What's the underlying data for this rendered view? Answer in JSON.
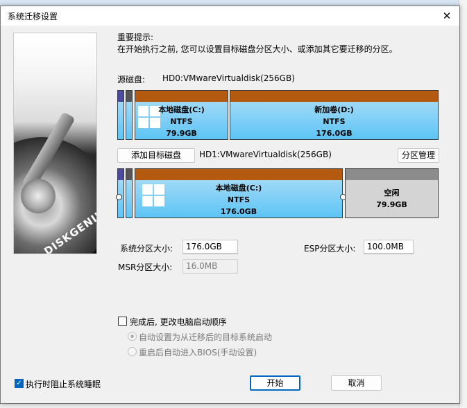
{
  "window": {
    "title": "系统迁移设置",
    "close_glyph": "✕"
  },
  "notice": {
    "heading": "重要提示:",
    "body": "在开始执行之前, 您可以设置目标磁盘分区大小、或添加其它要迁移的分区。"
  },
  "source": {
    "label": "源磁盘:",
    "disk_name": "HD0:VMwareVirtualdisk(256GB)",
    "partitions": [
      {
        "name": "本地磁盘(C:)",
        "fs": "NTFS",
        "size": "79.9GB"
      },
      {
        "name": "新加卷(D:)",
        "fs": "NTFS",
        "size": "176.0GB"
      }
    ]
  },
  "target": {
    "add_button": "添加目标磁盘",
    "disk_name": "HD1:VMwareVirtualdisk(256GB)",
    "manage_button": "分区管理",
    "partitions": [
      {
        "name": "本地磁盘(C:)",
        "fs": "NTFS",
        "size": "176.0GB"
      },
      {
        "name": "空闲",
        "size": "79.9GB"
      }
    ]
  },
  "sizes": {
    "system_label": "系统分区大小:",
    "system_value": "176.0GB",
    "esp_label": "ESP分区大小:",
    "esp_value": "100.0MB",
    "msr_label": "MSR分区大小:",
    "msr_value": "16.0MB"
  },
  "boot": {
    "change_order_label": "完成后, 更改电脑启动顺序",
    "change_order_checked": false,
    "option_auto": "自动设置为从迁移后的目标系统启动",
    "option_bios": "重启后自动进入BIOS(手动设置)"
  },
  "footer": {
    "prevent_sleep_label": "执行时阻止系统睡眠",
    "prevent_sleep_checked": true,
    "start_button": "开始",
    "cancel_button": "取消"
  },
  "art": {
    "brand": "DISKGENIUS"
  },
  "colors": {
    "partition_cap": "#b35a10",
    "partition_body": "#5cc4f5",
    "free_body": "#d4d4d4",
    "accent": "#0067c0"
  },
  "icons": [
    "close-icon",
    "windows-logo-icon",
    "checkmark-icon",
    "hard-disk-art"
  ]
}
